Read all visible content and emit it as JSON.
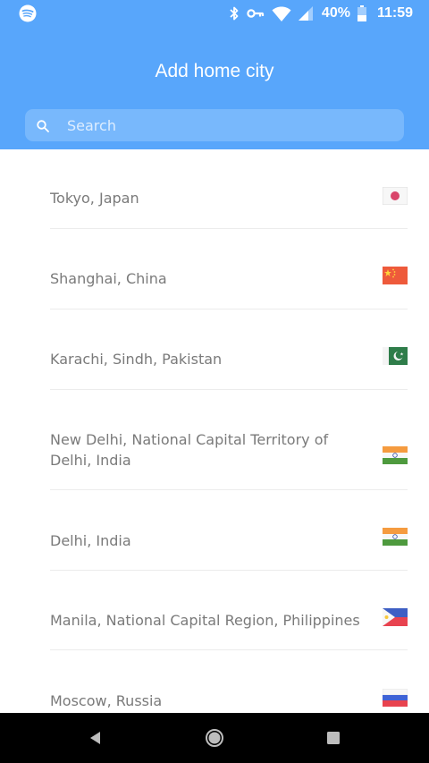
{
  "status_bar": {
    "app_icon": "spotify-icon",
    "battery": "40%",
    "time": "11:59"
  },
  "header": {
    "title": "Add home city"
  },
  "search": {
    "placeholder": "Search",
    "value": ""
  },
  "cities": [
    {
      "name": "Tokyo, Japan",
      "flag": "japan-flag-icon"
    },
    {
      "name": "Shanghai, China",
      "flag": "china-flag-icon"
    },
    {
      "name": "Karachi, Sindh, Pakistan",
      "flag": "pakistan-flag-icon"
    },
    {
      "name": "New Delhi, National Capital Territory of Delhi, India",
      "flag": "india-flag-icon"
    },
    {
      "name": "Delhi, India",
      "flag": "india-flag-icon"
    },
    {
      "name": "Manila, National Capital Region, Philippines",
      "flag": "philippines-flag-icon"
    },
    {
      "name": "Moscow, Russia",
      "flag": "russia-flag-icon"
    }
  ],
  "colors": {
    "header": "#58a6fb",
    "search_bg": "#78b8fc",
    "text": "#7a7a7a"
  }
}
